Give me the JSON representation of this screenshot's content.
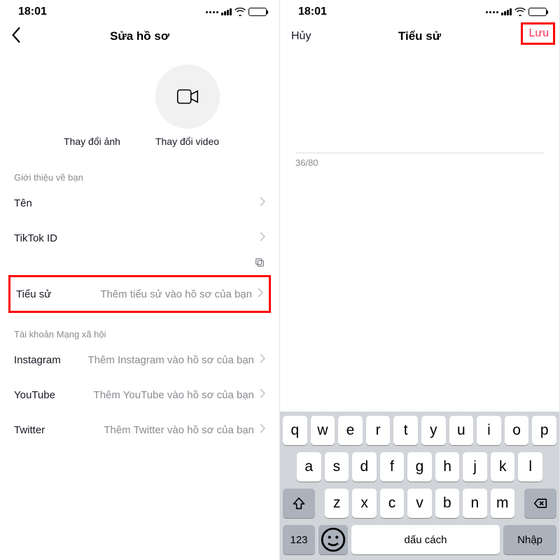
{
  "status": {
    "time": "18:01"
  },
  "left": {
    "nav_title": "Sửa hồ sơ",
    "change_photo": "Thay đổi ảnh",
    "change_video": "Thay đổi video",
    "section_about": "Giới thiệu về bạn",
    "rows": {
      "name_label": "Tên",
      "tiktokid_label": "TikTok ID",
      "bio_label": "Tiểu sử",
      "bio_placeholder": "Thêm tiểu sử vào hồ sơ của bạn"
    },
    "section_social": "Tài khoản Mạng xã hội",
    "social": {
      "instagram_label": "Instagram",
      "instagram_placeholder": "Thêm Instagram vào hồ sơ của bạn",
      "youtube_label": "YouTube",
      "youtube_placeholder": "Thêm YouTube vào hồ sơ của bạn",
      "twitter_label": "Twitter",
      "twitter_placeholder": "Thêm Twitter vào hồ sơ của bạn"
    }
  },
  "right": {
    "nav_cancel": "Hủy",
    "nav_title": "Tiểu sử",
    "nav_save": "Lưu",
    "bio_text": "",
    "counter": "36/80"
  },
  "keyboard": {
    "row1": [
      "q",
      "w",
      "e",
      "r",
      "t",
      "y",
      "u",
      "i",
      "o",
      "p"
    ],
    "row2": [
      "a",
      "s",
      "d",
      "f",
      "g",
      "h",
      "j",
      "k",
      "l"
    ],
    "row3": [
      "z",
      "x",
      "c",
      "v",
      "b",
      "n",
      "m"
    ],
    "numkey": "123",
    "space": "dấu cách",
    "enter": "Nhập"
  }
}
